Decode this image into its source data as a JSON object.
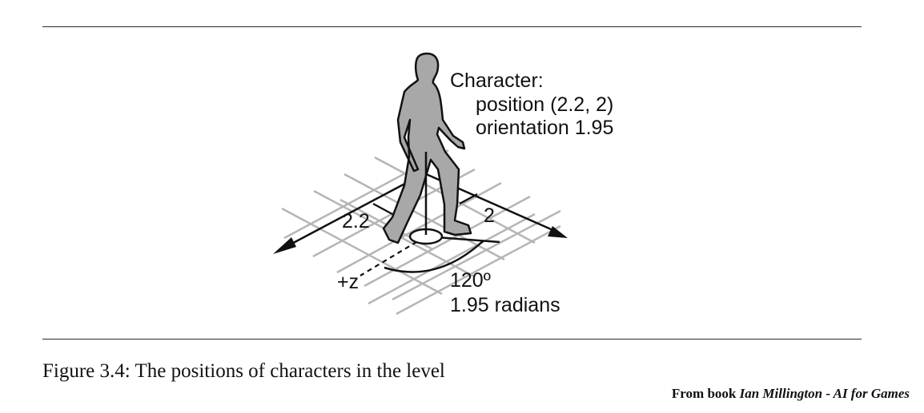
{
  "diagram": {
    "character_heading": "Character:",
    "position_text": "position (2.2, 2)",
    "orientation_text": "orientation 1.95",
    "x_offset_label": "2.2",
    "z_offset_label": "2",
    "axis_label": "+z",
    "angle_degrees_label": "120º",
    "angle_radians_label": "1.95 radians"
  },
  "caption": {
    "text": "Figure 3.4: The positions of characters in the level"
  },
  "credit": {
    "prefix": "From book ",
    "author_title": "Ian Millington - AI for Games"
  },
  "colors": {
    "grid": "#b5b5b5",
    "figure_fill": "#a8a8a8",
    "ink": "#111111"
  }
}
